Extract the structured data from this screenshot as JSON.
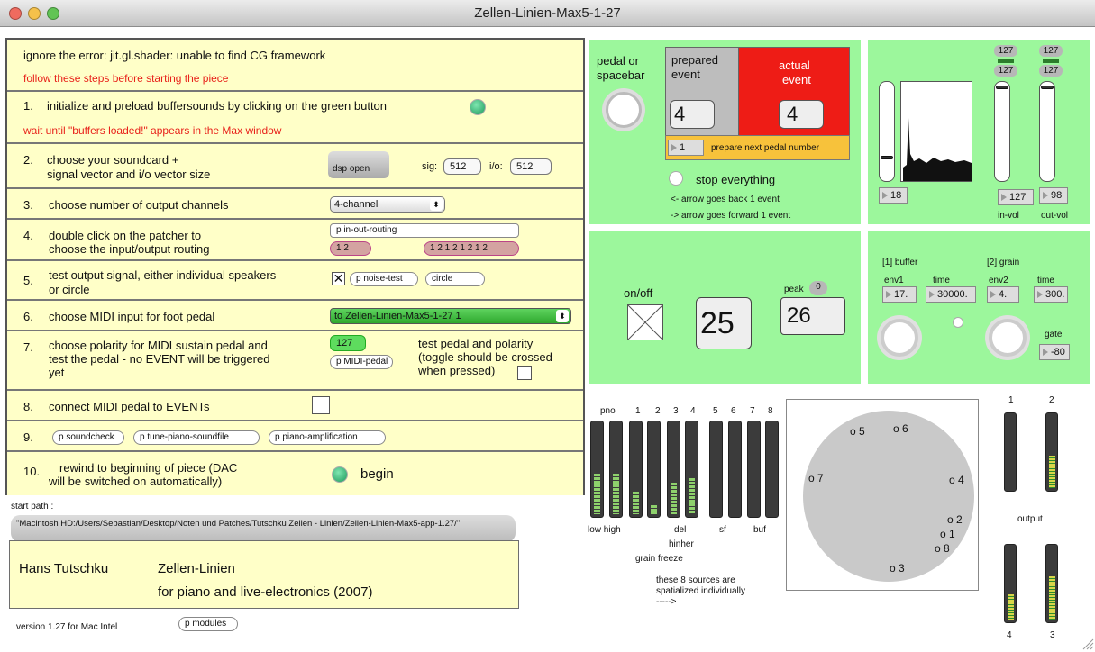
{
  "window": {
    "title": "Zellen-Linien-Max5-1-27"
  },
  "steps": {
    "error": "ignore the error: jit.gl.shader: unable to find CG framework",
    "follow": "follow these steps before starting the piece",
    "s1": {
      "num": "1.",
      "text": "initialize and preload buffersounds by clicking on the green button",
      "wait": "wait until \"buffers loaded!\" appears in the Max window"
    },
    "s2": {
      "num": "2.",
      "text1": "choose your soundcard +",
      "text2": "signal vector and i/o vector  size",
      "dsp": "dsp open",
      "sig_label": "sig:",
      "sig": "512",
      "io_label": "i/o:",
      "io": "512"
    },
    "s3": {
      "num": "3.",
      "text": "choose number of output channels",
      "select": "4-channel"
    },
    "s4": {
      "num": "4.",
      "text1": "double click on the patcher to",
      "text2": "choose the input/output routing",
      "patcher": "p in-out-routing",
      "a": "1 2",
      "b": "1 2 1 2 1 2 1 2"
    },
    "s5": {
      "num": "5.",
      "text1": "test output signal, either individual speakers",
      "text2": "or circle",
      "noise": "p noise-test",
      "circle": "circle"
    },
    "s6": {
      "num": "6.",
      "text": "choose MIDI input for foot pedal",
      "select": "to Zellen-Linien-Max5-1-27 1"
    },
    "s7": {
      "num": "7.",
      "text1": "choose polarity for MIDI sustain pedal and",
      "text2": "test the pedal - no EVENT will be triggered",
      "text3": "yet",
      "value": "127",
      "midi": "p MIDI-pedal",
      "test1": "test pedal and polarity",
      "test2": "(toggle should be crossed",
      "test3": "when pressed)"
    },
    "s8": {
      "num": "8.",
      "text": "connect MIDI pedal to EVENTs"
    },
    "s9": {
      "num": "9.",
      "a": "p soundcheck",
      "b": "p tune-piano-soundfile",
      "c": "p piano-amplification"
    },
    "s10": {
      "num": "10.",
      "text1": "rewind to beginning of piece (DAC",
      "text2": "will be switched on automatically)",
      "begin": "begin"
    }
  },
  "path": {
    "label": "start path :",
    "value": "\"Macintosh HD:/Users/Sebastian/Desktop/Noten und Patches/Tutschku Zellen - Linien/Zellen-Linien-Max5-app-1.27/\""
  },
  "credits": {
    "composer": "Hans Tutschku",
    "title": "Zellen-Linien",
    "subtitle": "for piano and live-electronics (2007)"
  },
  "footer": {
    "version": "version 1.27 for Mac Intel",
    "modules": "p modules"
  },
  "event": {
    "pedal1": "pedal or",
    "pedal2": "spacebar",
    "prepared1": "prepared",
    "prepared2": "event",
    "actual1": "actual",
    "actual2": "event",
    "prepared_val": "4",
    "actual_val": "4",
    "next_val": "1",
    "next_label": "prepare next pedal number",
    "stop": "stop everything",
    "back": "<- arrow goes back 1 event",
    "fwd": "-> arrow goes forward 1 event"
  },
  "vol": {
    "in_top": "127",
    "out_top": "127",
    "in_top2": "127",
    "out_top2": "127",
    "slider_val": "18",
    "in_val": "127",
    "out_val": "98",
    "in_label": "in-vol",
    "out_label": "out-vol"
  },
  "onoff": {
    "label": "on/off",
    "big": "25",
    "peak_label": "peak",
    "peak_badge": "0",
    "peak": "26"
  },
  "grain": {
    "buffer_label": "[1] buffer",
    "grain_label": "[2] grain",
    "env1": "env1",
    "time1": "time",
    "env2": "env2",
    "time2": "time",
    "env1_val": "17.",
    "time1_val": "30000.",
    "env2_val": "4.",
    "time2_val": "300.",
    "gate": "gate",
    "gate_val": "-80"
  },
  "meters": {
    "heads": [
      "pno",
      "1",
      "2",
      "3",
      "4",
      "5",
      "6",
      "7",
      "8"
    ],
    "labels": [
      "low high",
      "del",
      "hinher",
      "grain freeze",
      "sf",
      "buf"
    ],
    "note1": "these 8 sources are",
    "note2": "spatialized individually",
    "note3": "----->",
    "levels": [
      0.45,
      0.45,
      0.25,
      0.1,
      0.35,
      0.4,
      0,
      0,
      0,
      0
    ]
  },
  "spatial": {
    "points": [
      "5",
      "6",
      "7",
      "4",
      "2",
      "1",
      "8",
      "3"
    ]
  },
  "output": {
    "top": [
      "1",
      "2"
    ],
    "label": "output",
    "bottom": [
      "4",
      "3"
    ],
    "levels": [
      0,
      0.45,
      0.35,
      0.6
    ]
  }
}
